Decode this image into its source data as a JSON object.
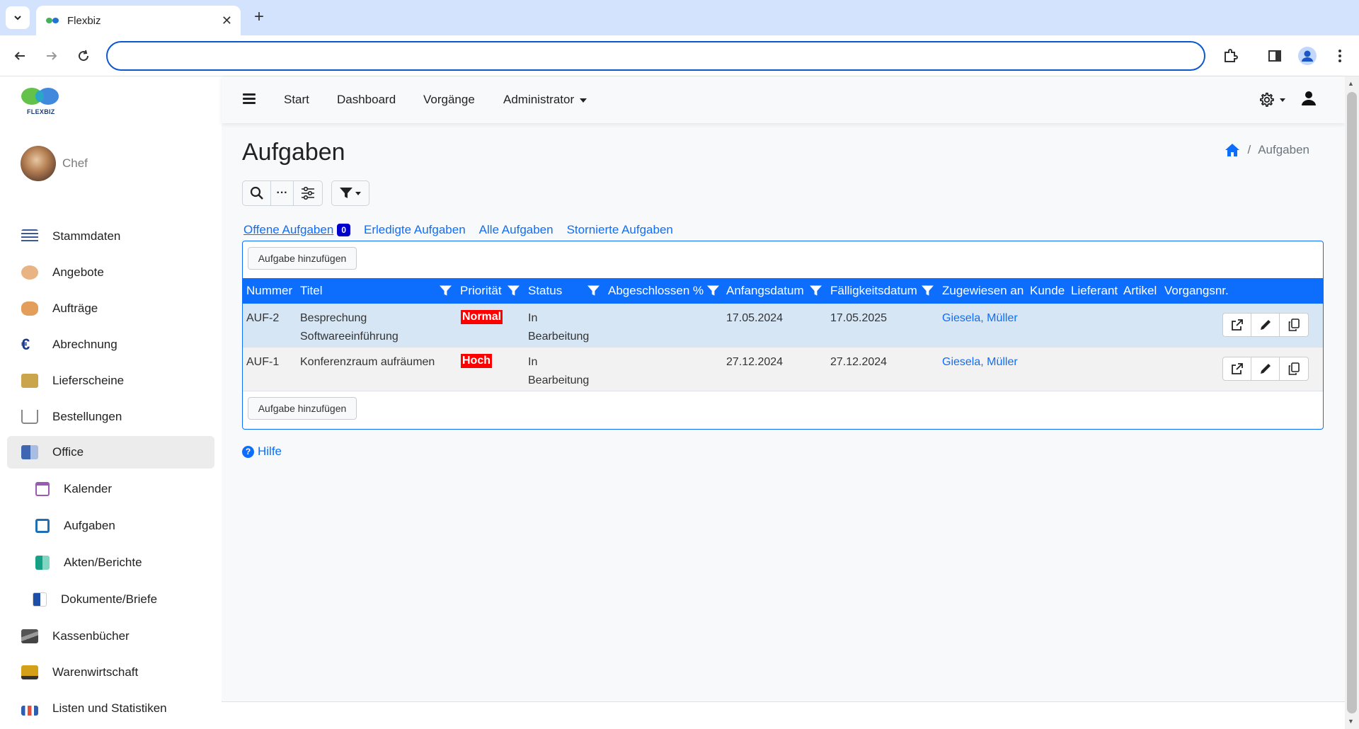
{
  "browser": {
    "tab_title": "Flexbiz",
    "tab_close": "✕",
    "new_tab": "+",
    "address": ""
  },
  "logo": {
    "text": "FLEXBIZ"
  },
  "user": {
    "name": "Chef"
  },
  "sidebar": {
    "items": [
      {
        "label": "Stammdaten",
        "icon": "stammdaten-icon",
        "color": "#3b5998"
      },
      {
        "label": "Angebote",
        "icon": "angebote-icon",
        "color": "#e8b483"
      },
      {
        "label": "Aufträge",
        "icon": "auftraege-icon",
        "color": "#e39e5b"
      },
      {
        "label": "Abrechnung",
        "icon": "euro-icon",
        "color": "#1a3a8a"
      },
      {
        "label": "Lieferscheine",
        "icon": "lieferscheine-icon",
        "color": "#caa54b"
      },
      {
        "label": "Bestellungen",
        "icon": "cart-icon",
        "color": "#888888"
      },
      {
        "label": "Office",
        "icon": "office-icon",
        "color": "#3f66b0"
      }
    ],
    "subitems": [
      {
        "label": "Kalender",
        "icon": "calendar-icon",
        "color": "#9b59b6"
      },
      {
        "label": "Aufgaben",
        "icon": "tasks-icon",
        "color": "#1f6fb5"
      },
      {
        "label": "Akten/Berichte",
        "icon": "files-icon",
        "color": "#16a085"
      },
      {
        "label": "Dokumente/Briefe",
        "icon": "documents-icon",
        "color": "#1e4fa8"
      }
    ],
    "items_after": [
      {
        "label": "Kassenbücher",
        "icon": "cashbook-icon",
        "color": "#555555"
      },
      {
        "label": "Warenwirtschaft",
        "icon": "forklift-icon",
        "color": "#d4a017"
      },
      {
        "label": "Listen und Statistiken",
        "icon": "statistics-icon",
        "color": "#2c5fb0"
      }
    ]
  },
  "topnav": {
    "links": [
      "Start",
      "Dashboard",
      "Vorgänge",
      "Administrator"
    ]
  },
  "page": {
    "title": "Aufgaben",
    "breadcrumb_current": "Aufgaben",
    "breadcrumb_sep": "/"
  },
  "tools": {
    "more": "···"
  },
  "filter_tabs": {
    "open": "Offene Aufgaben",
    "open_count": "0",
    "done": "Erledigte Aufgaben",
    "all": "Alle Aufgaben",
    "cancelled": "Stornierte Aufgaben"
  },
  "table": {
    "add_label": "Aufgabe hinzufügen",
    "headers": {
      "nummer": "Nummer",
      "titel": "Titel",
      "prioritaet": "Priorität",
      "status": "Status",
      "abgeschlossen": "Abgeschlossen %",
      "anfangsdatum": "Anfangsdatum",
      "faelligkeitsdatum": "Fälligkeitsdatum",
      "zugewiesen": "Zugewiesen an",
      "kunde": "Kunde",
      "lieferant": "Lieferant",
      "artikel": "Artikel",
      "vorgangsnr": "Vorgangsnr."
    },
    "rows": [
      {
        "nummer": "AUF-2",
        "titel_line1": "Besprechung",
        "titel_line2": "Softwareeinführung",
        "prioritaet": "Normal",
        "status_line1": "In",
        "status_line2": "Bearbeitung",
        "anfangsdatum": "17.05.2024",
        "faelligkeitsdatum": "17.05.2025",
        "zugewiesen": "Giesela, Müller"
      },
      {
        "nummer": "AUF-1",
        "titel_line1": "Konferenzraum aufräumen",
        "titel_line2": "",
        "prioritaet": "Hoch",
        "status_line1": "In",
        "status_line2": "Bearbeitung",
        "anfangsdatum": "27.12.2024",
        "faelligkeitsdatum": "27.12.2024",
        "zugewiesen": "Giesela, Müller"
      }
    ]
  },
  "help": {
    "label": "Hilfe",
    "icon_char": "?"
  },
  "colors": {
    "primary": "#0d6efd",
    "badge": "#0000cc",
    "priority": "#ff0000",
    "row_selected": "#d6e6f5"
  }
}
